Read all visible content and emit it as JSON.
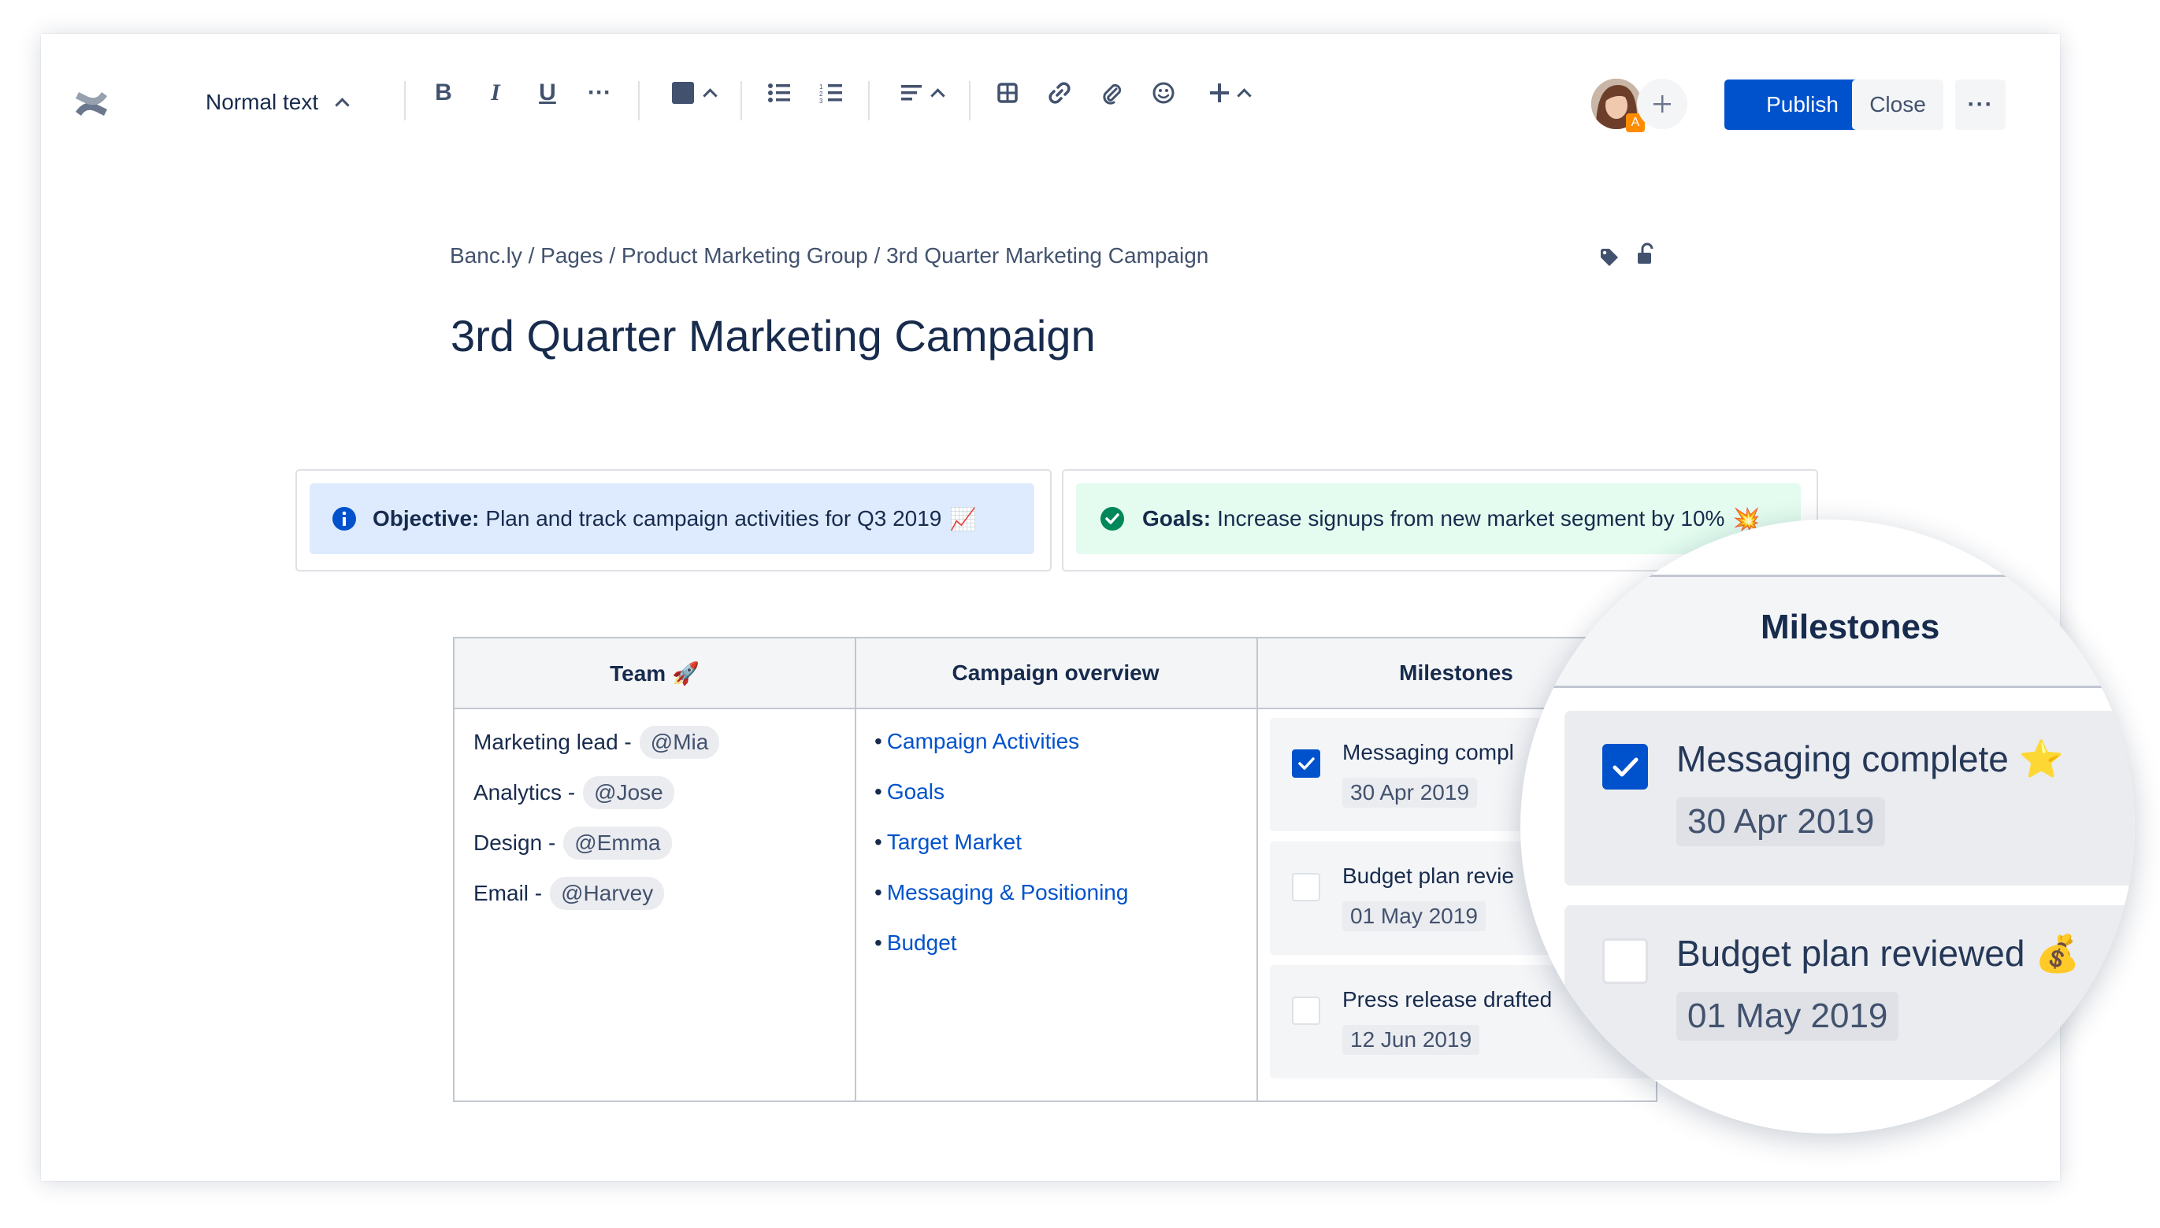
{
  "toolbar": {
    "text_style": "Normal text",
    "publish_label": "Publish",
    "close_label": "Close",
    "more_label": "···",
    "icons": [
      "confluence-logo-icon",
      "bold-icon",
      "italic-icon",
      "underline-icon",
      "more-formatting-icon",
      "text-color-icon",
      "bullet-list-icon",
      "numbered-list-icon",
      "align-icon",
      "table-icon",
      "link-icon",
      "attachment-icon",
      "emoji-icon",
      "insert-icon"
    ]
  },
  "colors": {
    "accent": "#0052cc",
    "text": "#172b4d",
    "info_bg": "#deebff",
    "success_bg": "#e3fcef",
    "success": "#00875a",
    "avatar_badge": "#ff8b00"
  },
  "breadcrumb": [
    "Banc.ly",
    "Pages",
    "Product Marketing Group",
    "3rd Quarter Marketing Campaign"
  ],
  "breadcrumb_sep": "/",
  "page_title": "3rd Quarter Marketing Campaign",
  "avatar_badge": "A",
  "objective": {
    "label": "Objective:",
    "text": "Plan and track campaign activities for Q3 2019",
    "emoji": "📈"
  },
  "goals": {
    "label": "Goals:",
    "text": "Increase signups from new market segment by 10%",
    "emoji": "💥"
  },
  "table": {
    "headers": {
      "team": "Team 🚀",
      "overview": "Campaign overview",
      "milestones": "Milestones"
    },
    "team": [
      {
        "role": "Marketing lead -",
        "mention": "@Mia"
      },
      {
        "role": "Analytics -",
        "mention": "@Jose"
      },
      {
        "role": "Design -",
        "mention": "@Emma"
      },
      {
        "role": "Email -",
        "mention": "@Harvey"
      }
    ],
    "overview_bullet": "•",
    "overview": [
      "Campaign Activities",
      "Goals",
      "Target Market",
      "Messaging & Positioning",
      "Budget"
    ],
    "milestones": [
      {
        "text": "Messaging compl",
        "date": "30 Apr 2019",
        "checked": true
      },
      {
        "text": "Budget plan revie",
        "date": "01 May 2019",
        "checked": false
      },
      {
        "text": "Press release drafted",
        "date": "12 Jun 2019",
        "checked": false
      }
    ]
  },
  "magnifier": {
    "title": "Milestones",
    "items": [
      {
        "text": "Messaging complete ⭐",
        "date": "30 Apr 2019",
        "checked": true
      },
      {
        "text": "Budget plan reviewed 💰",
        "date": "01 May 2019",
        "checked": false
      }
    ]
  }
}
